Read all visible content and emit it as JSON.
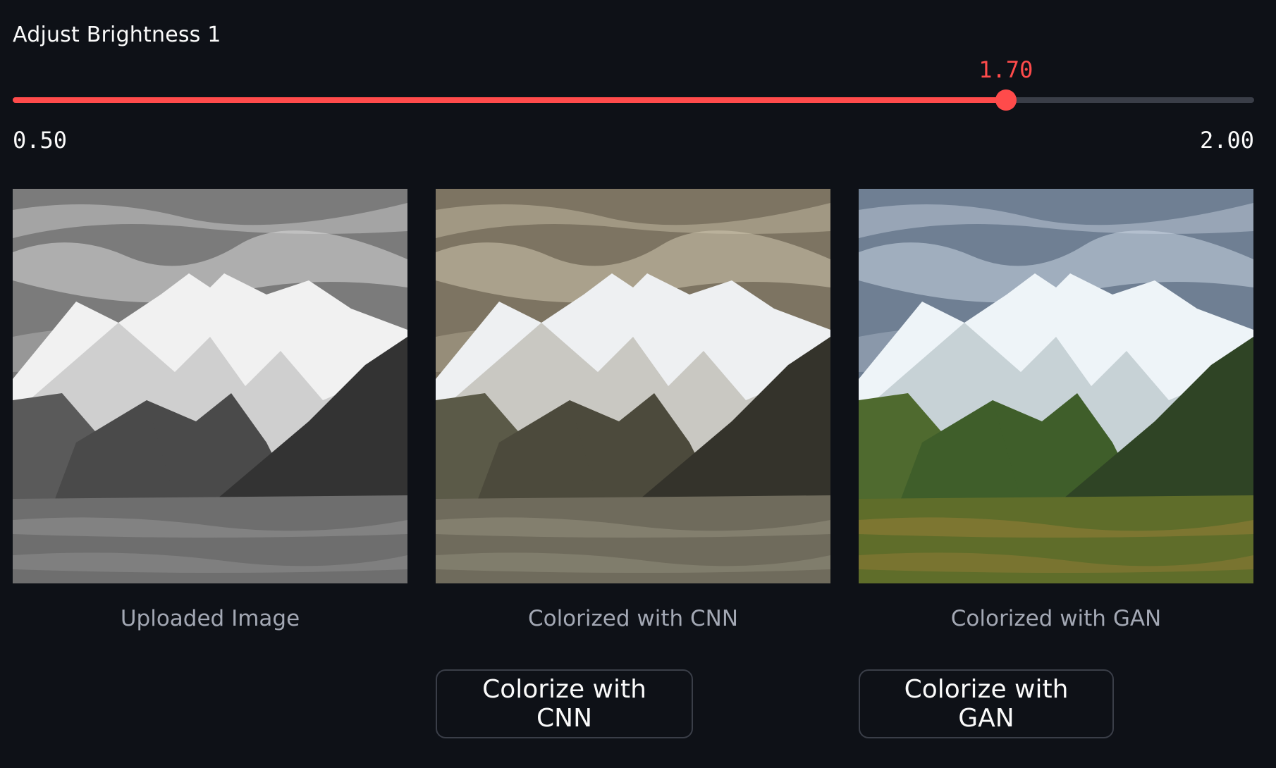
{
  "slider": {
    "label": "Adjust Brightness 1",
    "value": 1.7,
    "value_label": "1.70",
    "min": 0.5,
    "min_label": "0.50",
    "max": 2.0,
    "max_label": "2.00",
    "accent_color": "#ff4b4b"
  },
  "images": [
    {
      "caption": "Uploaded Image",
      "tint": "grayscale"
    },
    {
      "caption": "Colorized with CNN",
      "tint": "sepia"
    },
    {
      "caption": "Colorized with GAN",
      "tint": "natural"
    }
  ],
  "buttons": {
    "cnn_label": "Colorize with CNN",
    "gan_label": "Colorize with GAN"
  },
  "colors": {
    "background": "#0e1117",
    "text": "#fafafa",
    "caption": "#a3a8b4",
    "accent": "#ff4b4b"
  }
}
